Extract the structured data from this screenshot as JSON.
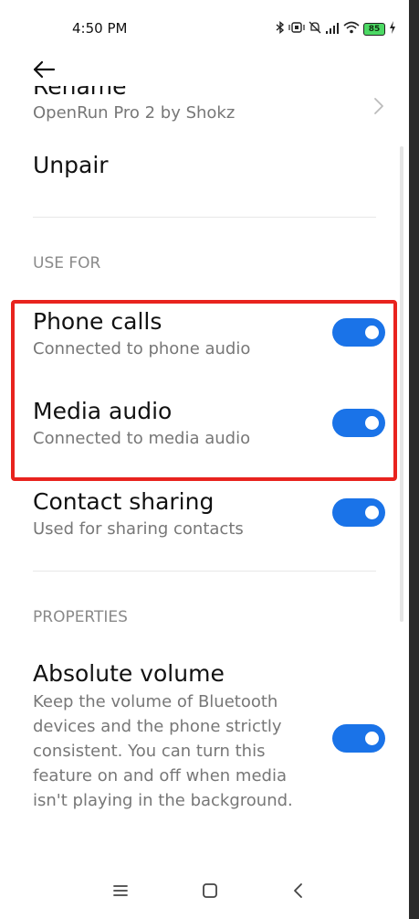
{
  "status_bar": {
    "time": "4:50 PM",
    "battery": "85"
  },
  "device": {
    "rename_label": "Rename",
    "device_name": "OpenRun Pro 2 by Shokz",
    "unpair_label": "Unpair"
  },
  "use_for": {
    "header": "USE FOR",
    "items": [
      {
        "title": "Phone calls",
        "subtitle": "Connected to phone audio",
        "enabled": true
      },
      {
        "title": "Media audio",
        "subtitle": "Connected to media audio",
        "enabled": true
      },
      {
        "title": "Contact sharing",
        "subtitle": "Used for sharing contacts",
        "enabled": true
      }
    ]
  },
  "properties": {
    "header": "PROPERTIES",
    "items": [
      {
        "title": "Absolute volume",
        "subtitle": "Keep the volume of Bluetooth devices and the phone strictly consistent. You can turn this feature on and off when media isn't playing in the background.",
        "enabled": true
      }
    ]
  },
  "colors": {
    "toggle_on": "#1a73e8",
    "highlight": "#e8231e"
  },
  "icons": {
    "back": "back-arrow-icon",
    "chevron": "chevron-right-icon",
    "nav_menu": "menu-icon",
    "nav_home": "home-icon",
    "nav_back": "nav-back-icon"
  }
}
